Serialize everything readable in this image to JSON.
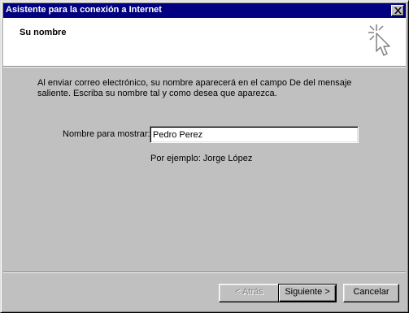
{
  "window": {
    "title": "Asistente para la conexión a Internet"
  },
  "header": {
    "title": "Su nombre",
    "icon": "wizard-cursor-icon"
  },
  "body": {
    "description": "Al enviar correo electrónico, su nombre aparecerá en el campo De del mensaje saliente. Escriba su nombre tal y como desea que aparezca.",
    "field_label": "Nombre para mostrar:",
    "field_value": "Pedro Perez",
    "example": "Por ejemplo: Jorge López"
  },
  "buttons": {
    "back": "< Atrás",
    "next": "Siguiente >",
    "cancel": "Cancelar"
  },
  "colors": {
    "titlebar": "#000080",
    "face": "#c0c0c0",
    "header_bg": "#ffffff"
  }
}
